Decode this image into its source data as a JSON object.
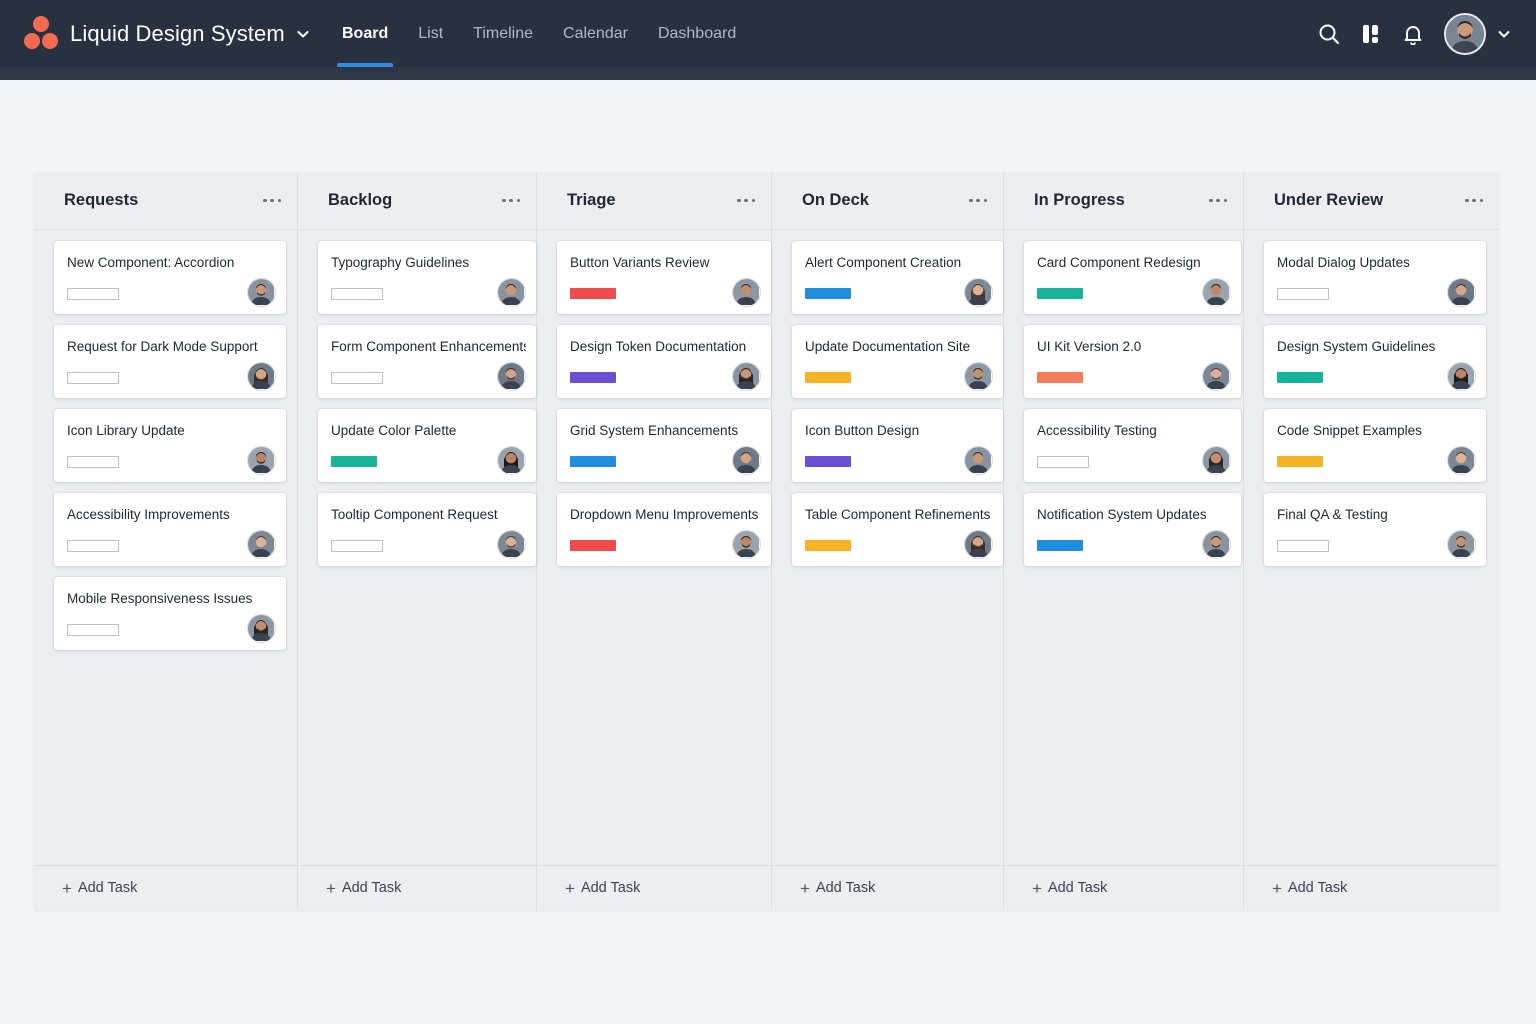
{
  "app": {
    "name": "Liquid Design System"
  },
  "nav": {
    "tabs": [
      {
        "label": "Board",
        "active": true
      },
      {
        "label": "List",
        "active": false
      },
      {
        "label": "Timeline",
        "active": false
      },
      {
        "label": "Calendar",
        "active": false
      },
      {
        "label": "Dashboard",
        "active": false
      }
    ]
  },
  "icons": {
    "brand": "asana-logo-icon",
    "brand_menu": "chevron-down-icon",
    "search": "search-icon",
    "apps": "apps-icon",
    "notifications": "bell-icon",
    "user_menu": "chevron-down-icon",
    "more": "more-horizontal-icon",
    "add": "plus-icon"
  },
  "colors": {
    "topbar": "#27313f",
    "accent": "#2f8bea",
    "brand": "#f26b51",
    "tags": {
      "red": "#f04a4a",
      "purple": "#6a4fd6",
      "blue": "#1f8ee0",
      "teal": "#14b39a",
      "yellow": "#f6b324",
      "orange": "#f47e5c"
    }
  },
  "board": {
    "add_task_label": "Add Task",
    "columns": [
      {
        "title": "Requests",
        "cards": [
          {
            "title": "New Component: Accordion",
            "tag": "empty"
          },
          {
            "title": "Request for Dark Mode Support",
            "tag": "empty"
          },
          {
            "title": "Icon Library Update",
            "tag": "empty"
          },
          {
            "title": "Accessibility Improvements",
            "tag": "empty"
          },
          {
            "title": "Mobile Responsiveness Issues",
            "tag": "empty"
          }
        ]
      },
      {
        "title": "Backlog",
        "cards": [
          {
            "title": "Typography Guidelines",
            "tag": "empty"
          },
          {
            "title": "Form Component Enhancements",
            "tag": "empty"
          },
          {
            "title": "Update Color Palette",
            "tag": "teal"
          },
          {
            "title": "Tooltip Component Request",
            "tag": "empty"
          }
        ]
      },
      {
        "title": "Triage",
        "cards": [
          {
            "title": "Button Variants Review",
            "tag": "red"
          },
          {
            "title": "Design Token Documentation",
            "tag": "purple"
          },
          {
            "title": "Grid System Enhancements",
            "tag": "blue"
          },
          {
            "title": "Dropdown Menu Improvements",
            "tag": "red"
          }
        ]
      },
      {
        "title": "On Deck",
        "cards": [
          {
            "title": "Alert Component Creation",
            "tag": "blue"
          },
          {
            "title": "Update Documentation Site",
            "tag": "yellow"
          },
          {
            "title": "Icon Button Design",
            "tag": "purple"
          },
          {
            "title": "Table Component Refinements",
            "tag": "yellow"
          }
        ]
      },
      {
        "title": "In Progress",
        "cards": [
          {
            "title": "Card Component Redesign",
            "tag": "teal"
          },
          {
            "title": "UI Kit Version 2.0",
            "tag": "orange"
          },
          {
            "title": "Accessibility Testing",
            "tag": "empty"
          },
          {
            "title": "Notification System Updates",
            "tag": "blue"
          }
        ]
      },
      {
        "title": "Under Review",
        "cards": [
          {
            "title": "Modal Dialog Updates",
            "tag": "empty"
          },
          {
            "title": "Design System Guidelines",
            "tag": "teal"
          },
          {
            "title": "Code Snippet Examples",
            "tag": "yellow"
          },
          {
            "title": "Final QA & Testing",
            "tag": "empty"
          }
        ]
      }
    ]
  }
}
